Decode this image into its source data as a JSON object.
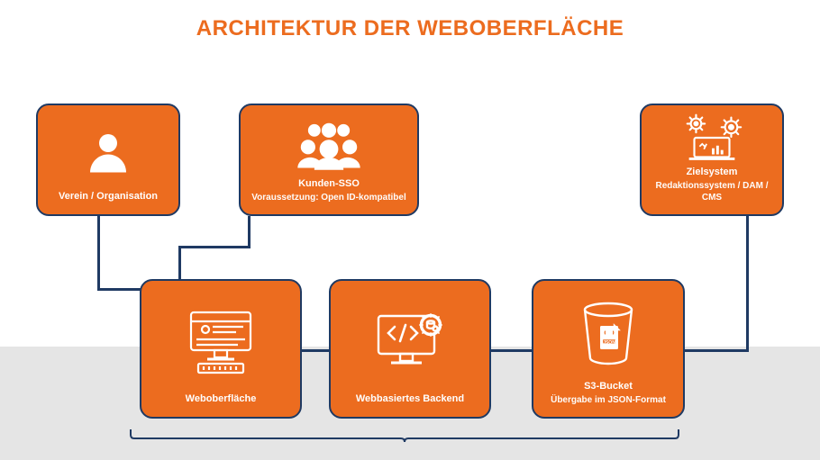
{
  "title": "ARCHITEKTUR DER WEBOBERFLÄCHE",
  "cards": {
    "org": {
      "line1": "Verein / Organisation"
    },
    "sso": {
      "line1": "Kunden-SSO",
      "line2": "Voraussetzung: Open ID-kompatibel"
    },
    "target": {
      "line1": "Zielsystem",
      "line2": "Redaktionssystem / DAM / CMS"
    },
    "ui": {
      "line1": "Weboberfläche"
    },
    "backend": {
      "line1": "Webbasiertes Backend"
    },
    "bucket": {
      "line1": "S3-Bucket",
      "line2": "Übergabe im JSON-Format"
    }
  }
}
